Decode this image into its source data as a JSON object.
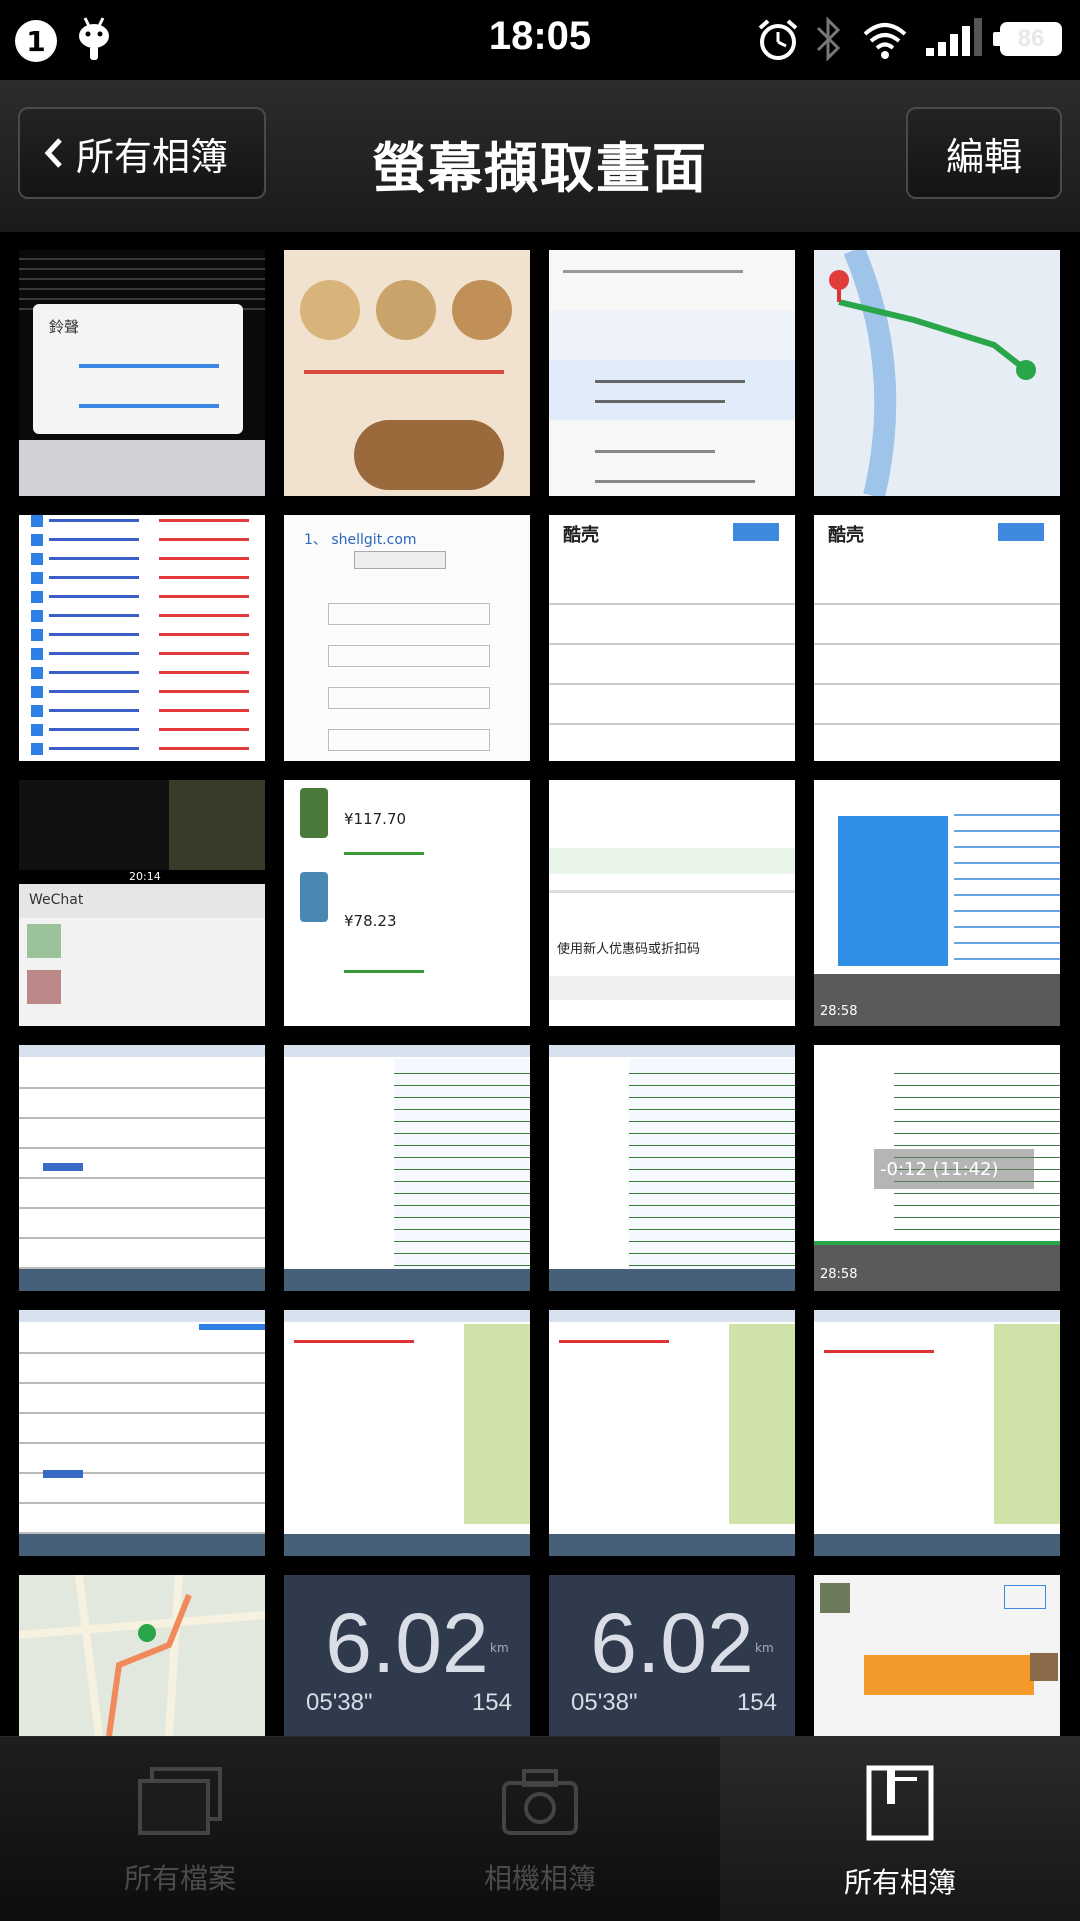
{
  "status_bar": {
    "notification_count": "1",
    "time": "18:05",
    "battery": "86",
    "icons": [
      "android-icon",
      "alarm-icon",
      "bluetooth-icon",
      "wifi-icon",
      "signal-icon",
      "battery-icon"
    ]
  },
  "nav": {
    "back_label": "所有相簿",
    "title": "螢幕擷取畫面",
    "edit_label": "編輯"
  },
  "grid": {
    "stats_thumb_1": {
      "distance": "6.02",
      "unit": "km",
      "pace": "05'38\"",
      "heart": "154"
    },
    "stats_thumb_2": {
      "distance": "6.02",
      "unit": "km",
      "pace": "05'38\"",
      "heart": "154"
    },
    "settings_thumb": {
      "label": "鈴聲"
    },
    "domain_thumb": {
      "label": "1、 shellgit.com"
    },
    "article_thumb_1": {
      "label": "酷壳"
    },
    "article_thumb_2": {
      "label": "酷壳"
    },
    "wechat_thumb": {
      "label": "WeChat",
      "time": "20:14"
    },
    "video_thumb": {
      "label": "-0:12 (11:42)"
    },
    "video_time_1": "28:58",
    "video_time_2": "28:58",
    "order_thumb": {
      "label": "使用新人优惠码或折扣码"
    },
    "shop_thumb": {
      "price1": "¥117.70",
      "price2": "¥78.23"
    }
  },
  "tab_bar": {
    "tabs": [
      {
        "label": "所有檔案",
        "active": false
      },
      {
        "label": "相機相簿",
        "active": false
      },
      {
        "label": "所有相簿",
        "active": true
      }
    ]
  },
  "colors": {
    "accent_blue": "#2f7fe6",
    "active_tab": "#ffffff",
    "inactive_tab": "#4b4b4b"
  }
}
